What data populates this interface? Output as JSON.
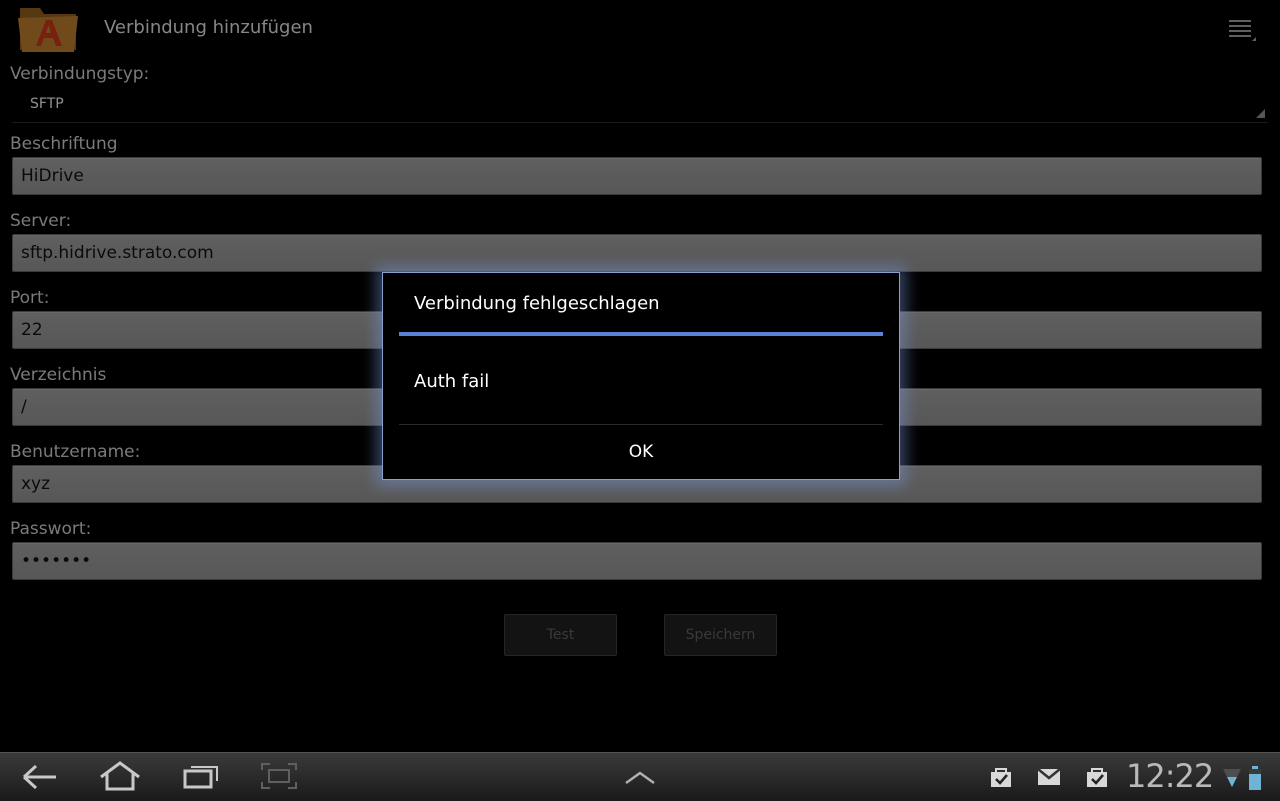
{
  "action_bar": {
    "title": "Verbindung hinzufügen",
    "app_icon": "folder-a-icon",
    "menu_icon": "overflow-menu-icon"
  },
  "form": {
    "connection_type": {
      "label": "Verbindungstyp:",
      "value": "SFTP"
    },
    "caption": {
      "label": "Beschriftung",
      "value": "HiDrive"
    },
    "server": {
      "label": "Server:",
      "value": "sftp.hidrive.strato.com"
    },
    "port": {
      "label": "Port:",
      "value": "22"
    },
    "directory": {
      "label": "Verzeichnis",
      "value": "/"
    },
    "username": {
      "label": "Benutzername:",
      "value": "xyz"
    },
    "password": {
      "label": "Passwort:",
      "value": "•••••••"
    },
    "test_button": "Test",
    "save_button": "Speichern"
  },
  "dialog": {
    "title": "Verbindung fehlgeschlagen",
    "message": "Auth fail",
    "ok_label": "OK"
  },
  "system_bar": {
    "time": "12:22",
    "nav_icons": [
      "back-icon",
      "home-icon",
      "recent-apps-icon",
      "screenshot-icon",
      "chevron-up-icon"
    ],
    "status_icons": [
      "shopping-bag-icon",
      "gmail-icon",
      "download-done-icon",
      "wifi-icon",
      "battery-icon"
    ]
  }
}
